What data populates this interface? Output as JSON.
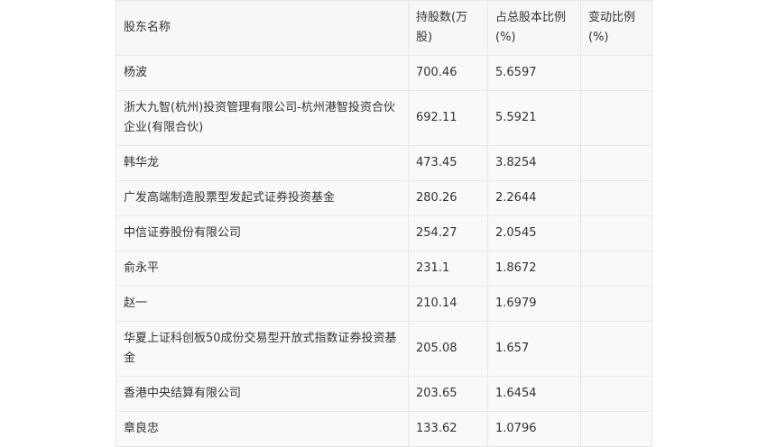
{
  "table": {
    "headers": [
      "股东名称",
      "持股数(万股)",
      "占总股本比例(%)",
      "变动比例(%)"
    ],
    "rows": [
      {
        "name": "杨波",
        "shares": "700.46",
        "ratio": "5.6597",
        "change": ""
      },
      {
        "name": "浙大九智(杭州)投资管理有限公司-杭州港智投资合伙企业(有限合伙)",
        "shares": "692.11",
        "ratio": "5.5921",
        "change": ""
      },
      {
        "name": "韩华龙",
        "shares": "473.45",
        "ratio": "3.8254",
        "change": ""
      },
      {
        "name": "广发高端制造股票型发起式证券投资基金",
        "shares": "280.26",
        "ratio": "2.2644",
        "change": ""
      },
      {
        "name": "中信证券股份有限公司",
        "shares": "254.27",
        "ratio": "2.0545",
        "change": ""
      },
      {
        "name": "俞永平",
        "shares": "231.1",
        "ratio": "1.8672",
        "change": ""
      },
      {
        "name": "赵一",
        "shares": "210.14",
        "ratio": "1.6979",
        "change": ""
      },
      {
        "name": "华夏上证科创板50成份交易型开放式指数证券投资基金",
        "shares": "205.08",
        "ratio": "1.657",
        "change": ""
      },
      {
        "name": "香港中央结算有限公司",
        "shares": "203.65",
        "ratio": "1.6454",
        "change": ""
      },
      {
        "name": "章良忠",
        "shares": "133.62",
        "ratio": "1.0796",
        "change": ""
      }
    ]
  }
}
